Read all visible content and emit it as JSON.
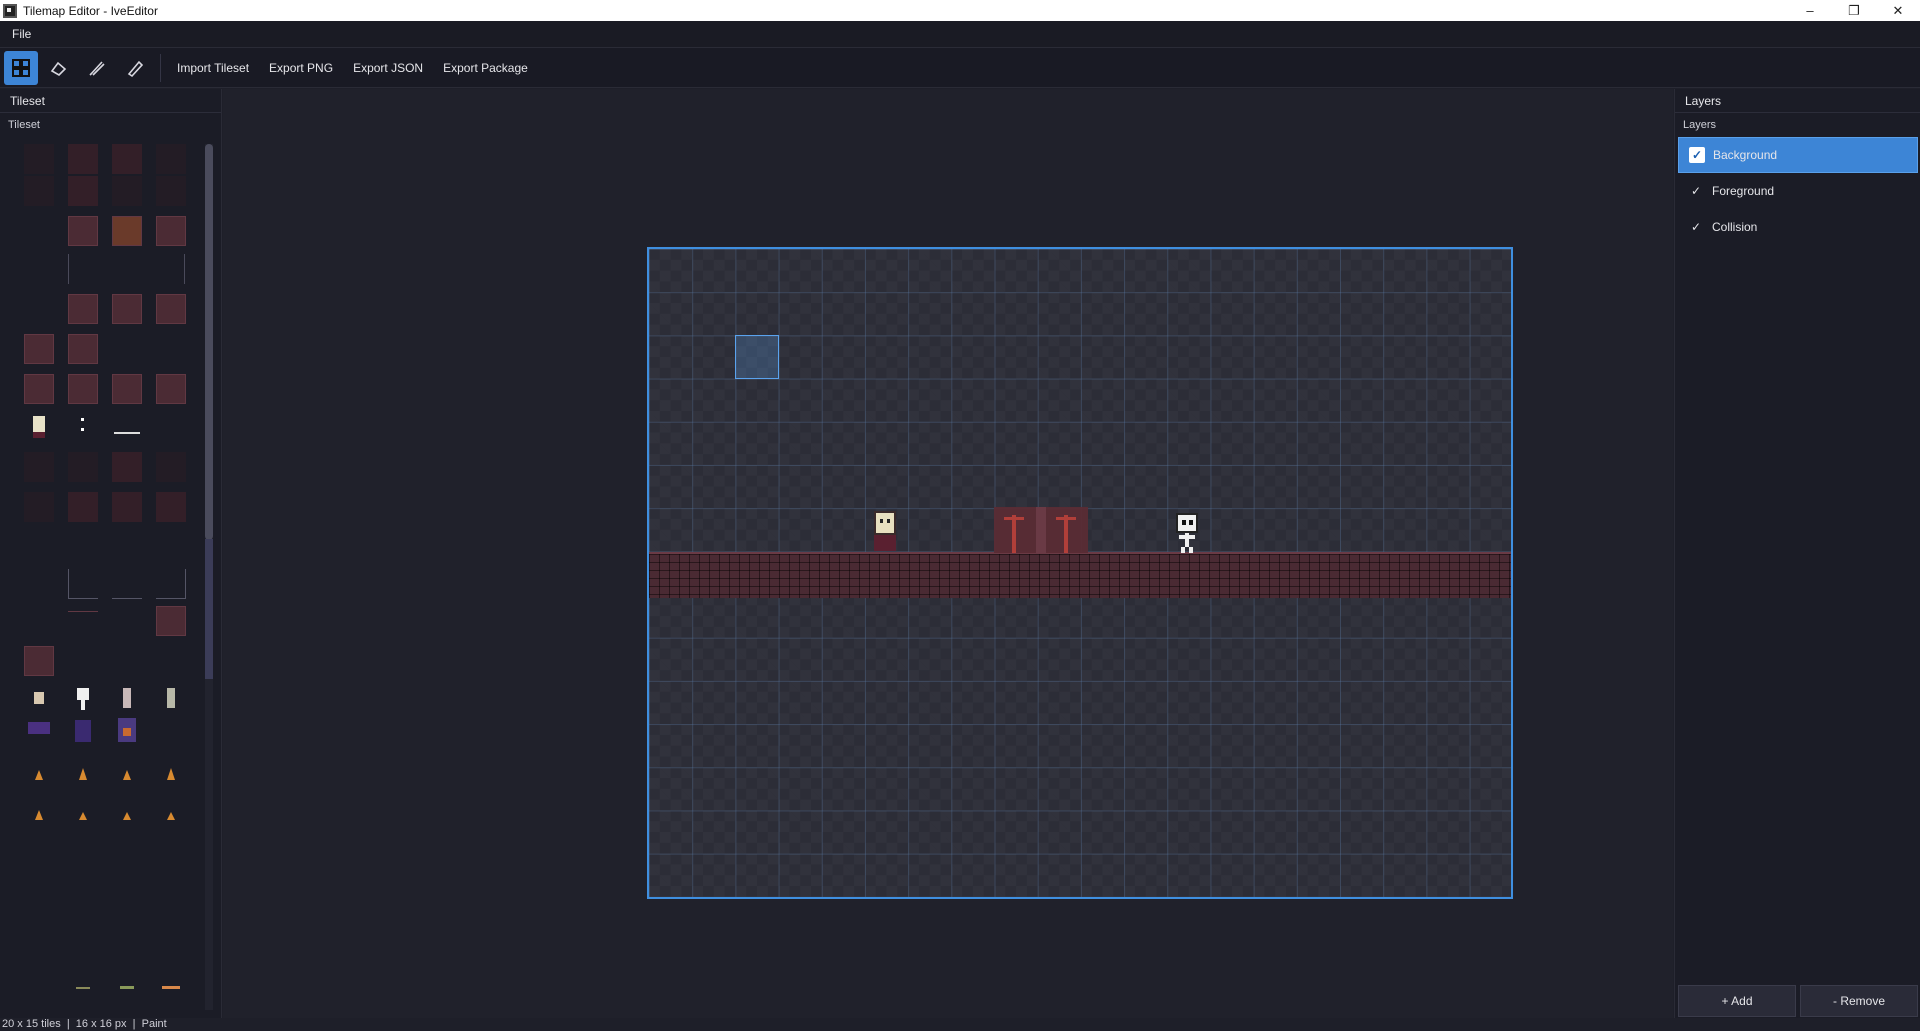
{
  "window": {
    "title": "Tilemap Editor - IveEditor",
    "minimize": "–",
    "maximize": "❐",
    "close": "✕"
  },
  "menu": {
    "file": "File"
  },
  "toolbar": {
    "tools": [
      "tile-paint-icon",
      "fill-icon",
      "brush-icon",
      "eraser-icon"
    ],
    "import_tileset": "Import Tileset",
    "export_png": "Export PNG",
    "export_json": "Export JSON",
    "export_package": "Export Package"
  },
  "left_panel": {
    "header": "Tileset",
    "subheader": "Tileset"
  },
  "right_panel": {
    "header": "Layers",
    "subheader": "Layers",
    "layers": [
      {
        "label": "Background",
        "checked": true,
        "selected": true
      },
      {
        "label": "Foreground",
        "checked": true,
        "selected": false
      },
      {
        "label": "Collision",
        "checked": true,
        "selected": false
      }
    ],
    "add_label": "+ Add",
    "remove_label": "- Remove"
  },
  "status": {
    "text": "20 x 15 tiles  |  16 x 16 px  |  Paint"
  },
  "colors": {
    "accent": "#3d85d6",
    "map_border": "#3f8fe0",
    "brick": "#4a2a33"
  }
}
